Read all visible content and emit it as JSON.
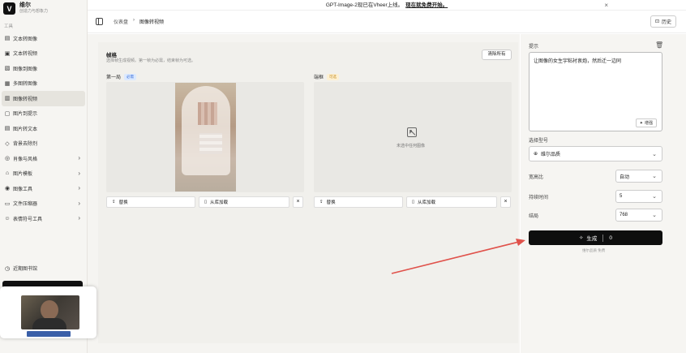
{
  "banner": {
    "text": "GPT-Image-2现已在Vheer上线。",
    "link": "现在就免费开始。"
  },
  "brand": {
    "name": "维尔",
    "tagline": "创造力与想象力"
  },
  "sidebar": {
    "section_label": "工具",
    "items": [
      {
        "label": "文本转图像",
        "icon": "text-image-icon"
      },
      {
        "label": "文本转视频",
        "icon": "text-video-icon"
      },
      {
        "label": "图像到图像",
        "icon": "image-image-icon"
      },
      {
        "label": "多图转图像",
        "icon": "multi-image-icon"
      },
      {
        "label": "图像转视频",
        "icon": "image-video-icon",
        "active": true
      },
      {
        "label": "图片到提示",
        "icon": "image-prompt-icon"
      },
      {
        "label": "图片转文本",
        "icon": "image-text-icon"
      },
      {
        "label": "背景去除剂",
        "icon": "eraser-icon"
      },
      {
        "label": "肖像与风格",
        "icon": "portrait-icon",
        "expand": true
      },
      {
        "label": "图片模板",
        "icon": "template-icon",
        "expand": true
      },
      {
        "label": "图像工具",
        "icon": "tools-icon",
        "expand": true
      },
      {
        "label": "文件压缩器",
        "icon": "compress-icon",
        "expand": true
      },
      {
        "label": "表情符号工具",
        "icon": "emoji-icon",
        "expand": true
      }
    ],
    "recent": "近期图书馆"
  },
  "header": {
    "breadcrumb": [
      "仪表盘",
      "图像转视频"
    ],
    "history_label": "历史"
  },
  "frames": {
    "title": "帧格",
    "description": "选择帧生成视频。第一帧为必需，结束帧为可选。",
    "clear_label": "清除所有",
    "first": {
      "label": "第一局",
      "tag": "必需",
      "replace_label": "替换",
      "library_label": "从库加载"
    },
    "end": {
      "label": "端框",
      "tag": "可选",
      "empty_text": "未选中任何图像",
      "replace_label": "替换",
      "library_label": "从库加载"
    }
  },
  "settings": {
    "prompt_label": "提示",
    "prompt_value": "让图像的女生宇粘衬衷炮，然后迁一边同",
    "enhance_label": "增强",
    "model_label": "选择型号",
    "model_value": "维尔品质",
    "aspect_label": "宽高比",
    "aspect_value": "自动",
    "duration_label": "持续时间",
    "duration_value": "5",
    "resolution_label": "结局",
    "resolution_value": "768",
    "generate_label": "生成",
    "generate_cost": "0",
    "credit_note": "维尔品质 免费"
  },
  "colors": {
    "accent": "#0e0e0e",
    "arrow": "#e0524b",
    "tag_required": "#3a6fd8",
    "tag_optional": "#c48a1a"
  }
}
